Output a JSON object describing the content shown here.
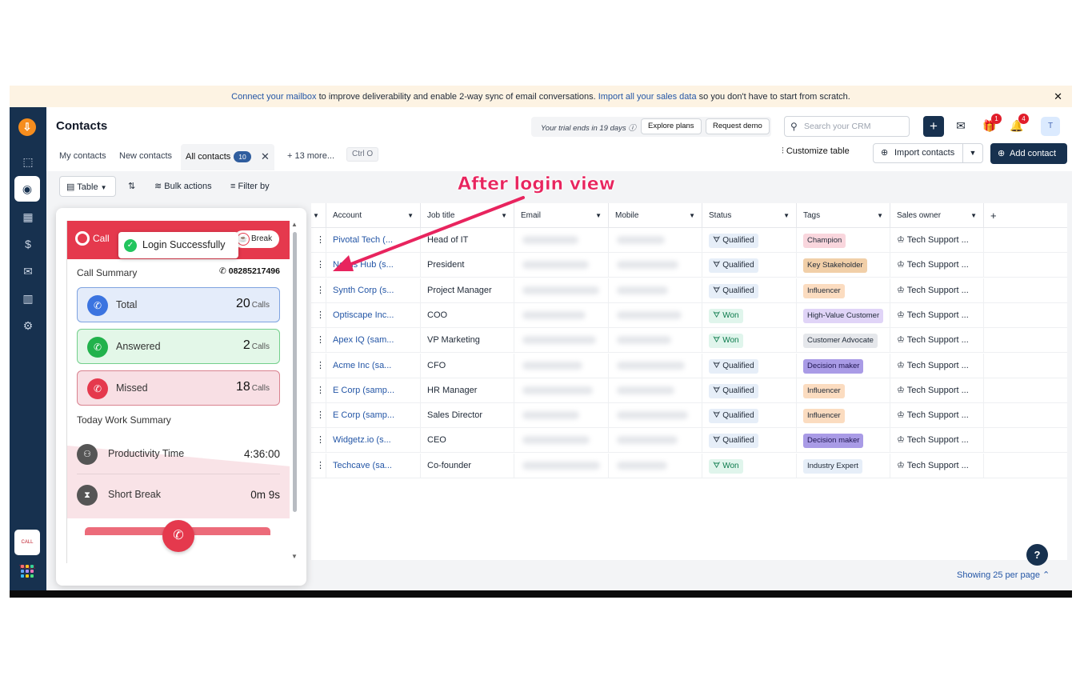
{
  "banner": {
    "link1": "Connect your mailbox",
    "text1": " to improve deliverability and enable 2-way sync of email conversations. ",
    "link2": "Import all your sales data",
    "text2": " so you don't have to start from scratch.",
    "close": "✕"
  },
  "sidebar": {
    "logo": "⇩",
    "icons": [
      "deals-icon",
      "contacts-icon",
      "accounts-icon",
      "revenue-icon",
      "email-icon",
      "reports-icon",
      "settings-icon"
    ],
    "app_label": "CALL TRACK"
  },
  "header": {
    "title": "Contacts",
    "trial": "Your trial ends in 19 days ⓘ",
    "explore": "Explore plans",
    "demo": "Request demo",
    "search_placeholder": "Search your CRM",
    "gift_badge": "1",
    "bell_badge": "4",
    "avatar": "T"
  },
  "tabs": {
    "my": "My contacts",
    "new": "New contacts",
    "all": "All contacts",
    "all_count": "10",
    "more": "+ 13 more...",
    "shortcut": "Ctrl O"
  },
  "actions": {
    "customize": "Customize table",
    "import": "Import contacts",
    "add": "Add contact"
  },
  "toolbar": {
    "table": "Table",
    "bulk": "Bulk actions",
    "filter": "Filter by"
  },
  "table": {
    "headers": [
      "Account",
      "Job title",
      "Email",
      "Mobile",
      "Status",
      "Tags",
      "Sales owner"
    ],
    "rows": [
      {
        "account": "Pivotal Tech (...",
        "job": "Head of IT",
        "status": "Qualified",
        "tag": "Champion",
        "owner": "Tech Support ..."
      },
      {
        "account": "Nexus Hub (s...",
        "job": "President",
        "status": "Qualified",
        "tag": "Key Stakeholder",
        "owner": "Tech Support ..."
      },
      {
        "account": "Synth Corp (s...",
        "job": "Project Manager",
        "status": "Qualified",
        "tag": "Influencer",
        "owner": "Tech Support ..."
      },
      {
        "account": "Optiscape Inc...",
        "job": "COO",
        "status": "Won",
        "tag": "High-Value Customer",
        "owner": "Tech Support ..."
      },
      {
        "account": "Apex IQ (sam...",
        "job": "VP Marketing",
        "status": "Won",
        "tag": "Customer Advocate",
        "owner": "Tech Support ..."
      },
      {
        "account": "Acme Inc (sa...",
        "job": "CFO",
        "status": "Qualified",
        "tag": "Decision maker",
        "owner": "Tech Support ..."
      },
      {
        "account": "E Corp (samp...",
        "job": "HR Manager",
        "status": "Qualified",
        "tag": "Influencer",
        "owner": "Tech Support ..."
      },
      {
        "account": "E Corp (samp...",
        "job": "Sales Director",
        "status": "Qualified",
        "tag": "Influencer",
        "owner": "Tech Support ..."
      },
      {
        "account": "Widgetz.io (s...",
        "job": "CEO",
        "status": "Qualified",
        "tag": "Decision maker",
        "owner": "Tech Support ..."
      },
      {
        "account": "Techcave (sa...",
        "job": "Co-founder",
        "status": "Won",
        "tag": "Industry Expert",
        "owner": "Tech Support ..."
      }
    ],
    "tag_colors": {
      "Champion": "#f9d6dd",
      "Key Stakeholder": "#f1cfa8",
      "Influencer": "#fbdcc0",
      "High-Value Customer": "#e0d4f7",
      "Customer Advocate": "#e5e7eb",
      "Decision maker": "#a99be6",
      "Industry Expert": "#e6eef8"
    },
    "footer": "Showing 25 per page ⌃"
  },
  "widget": {
    "brand": "Call",
    "break": "Break",
    "toast": "Login Successfully",
    "call_summary": "Call Summary",
    "phone": "08285217496",
    "total_label": "Total",
    "total_value": "20",
    "answered_label": "Answered",
    "answered_value": "2",
    "missed_label": "Missed",
    "missed_value": "18",
    "calls_unit": "Calls",
    "work_summary": "Today Work Summary",
    "productivity_label": "Productivity Time",
    "productivity_value": "4:36:00",
    "break_label": "Short Break",
    "break_value": "0m 9s"
  },
  "annotation": {
    "text": "After login view",
    "color": "#e8245e"
  },
  "help": "?"
}
